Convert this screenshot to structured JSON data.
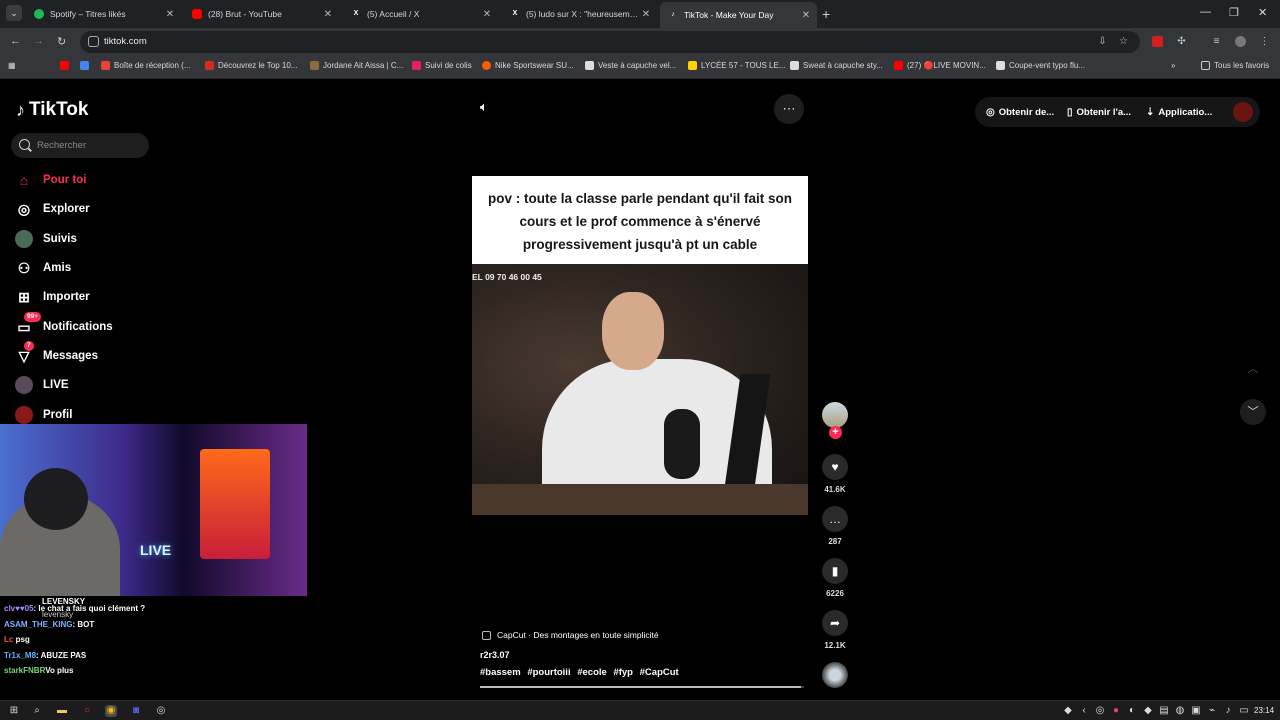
{
  "browser": {
    "tabs": [
      {
        "label": "Spotify – Titres likés",
        "icon": "spotify-icon",
        "color": "#1db954"
      },
      {
        "label": "(28) Brut - YouTube",
        "icon": "youtube-icon",
        "color": "#ff0000"
      },
      {
        "label": "(5) Accueil / X",
        "icon": "x-icon",
        "color": "#ffffff"
      },
      {
        "label": "(5) ludo sur X : \"heureusement",
        "icon": "x-icon",
        "color": "#ffffff"
      },
      {
        "label": "TikTok - Make Your Day",
        "icon": "tiktok-icon",
        "color": "#ffffff"
      }
    ],
    "url": "tiktok.com",
    "bookmarks": [
      {
        "label": "",
        "color": "#ff0000"
      },
      {
        "label": "",
        "color": "#4285f4"
      },
      {
        "label": "Boîte de réception (...",
        "color": "#ea4335"
      },
      {
        "label": "Découvrez le Top 10...",
        "color": "#d52b1e"
      },
      {
        "label": "Jordane Ait Aissa | C...",
        "color": "#8a6d3b"
      },
      {
        "label": "Suivi de colis",
        "color": "#e91e63"
      },
      {
        "label": "Nike Sportswear SU...",
        "color": "#ff5a00"
      },
      {
        "label": "Veste à capuche vel...",
        "color": "#dddddd"
      },
      {
        "label": "LYCÉE 57 - TOUS LE...",
        "color": "#ffd400"
      },
      {
        "label": "Sweat à capuche sty...",
        "color": "#dddddd"
      },
      {
        "label": "(27) 🔴LIVE MOVIN...",
        "color": "#ff0000"
      },
      {
        "label": "Coupe-vent typo flu...",
        "color": "#dddddd"
      }
    ],
    "all_bookmarks": "Tous les favoris"
  },
  "tiktok": {
    "logo": "TikTok",
    "search_placeholder": "Rechercher",
    "nav": [
      {
        "label": "Pour toi"
      },
      {
        "label": "Explorer"
      },
      {
        "label": "Suivis"
      },
      {
        "label": "Amis"
      },
      {
        "label": "Importer"
      },
      {
        "label": "Notifications",
        "badge": "99+"
      },
      {
        "label": "Messages",
        "badge": "7"
      },
      {
        "label": "LIVE"
      },
      {
        "label": "Profil"
      }
    ],
    "top_buttons": {
      "effects": "Obtenir de...",
      "app": "Obtenir l'a...",
      "install": "Applicatio..."
    },
    "video": {
      "caption": "pov : toute la classe parle pendant qu'il fait son cours et le prof commence à s'énervé progressivement jusqu'à pt un cable",
      "phone_overlay": "EL  09 70 46 00 45",
      "capcut": "CapCut · Des montages en toute simplicité",
      "author": "r2r3.07",
      "hashtags": [
        "#bassem",
        "#pourtoiii",
        "#ecole",
        "#fyp",
        "#CapCut"
      ],
      "progress": 0.99
    },
    "actions": {
      "likes": "41.6K",
      "comments": "287",
      "saves": "6226",
      "shares": "12.1K"
    }
  },
  "stream_overlay": {
    "neon_sign": "LIVE",
    "chat": [
      {
        "user": "LEVENSKY",
        "text": "",
        "color": "#ffffff"
      },
      {
        "user": "clv♥♥05",
        "text": ": le chat a fais quoi clément ?",
        "color": "#a98bff"
      },
      {
        "user": "levensky",
        "text": "",
        "color": "#cccccc"
      },
      {
        "user": "ASAM_THE_KING",
        "text": ": BOT",
        "color": "#7fb2ff"
      },
      {
        "user": "Lc",
        "text": "psg",
        "color": "#ff4a4a"
      },
      {
        "user": "Tr1x_M8",
        "text": ": ABUZE PAS",
        "color": "#5fb6ff"
      },
      {
        "user": "starkFNBR",
        "text": "Vo plus",
        "color": "#7ad67a"
      }
    ]
  },
  "taskbar": {
    "time": "23:14"
  }
}
